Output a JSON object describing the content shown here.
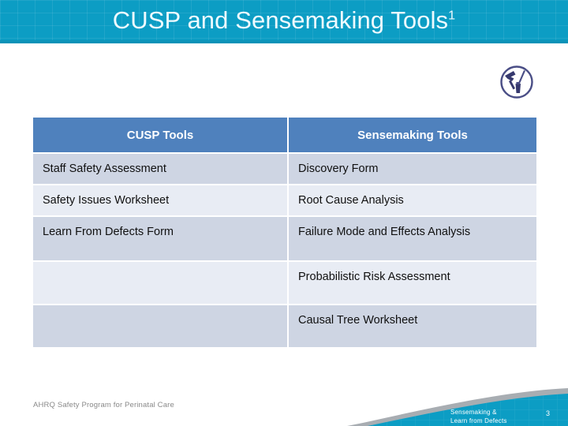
{
  "slide": {
    "title": "CUSP and Sensemaking Tools",
    "title_superscript": "1",
    "header_color": "#0c9dc4",
    "table_header_color": "#4f81bd",
    "row_color_a": "#ced5e3",
    "row_color_b": "#e8ecf4"
  },
  "logo": {
    "name": "toolkit-circle-logo",
    "color": "#36396e"
  },
  "table": {
    "headers": [
      "CUSP Tools",
      "Sensemaking Tools"
    ],
    "rows": [
      {
        "cusp": "Staff Safety Assessment",
        "sensemaking": "Discovery Form"
      },
      {
        "cusp": "Safety Issues Worksheet",
        "sensemaking": "Root Cause Analysis"
      },
      {
        "cusp": "Learn From Defects Form",
        "sensemaking": "Failure Mode and Effects Analysis"
      },
      {
        "cusp": "",
        "sensemaking": "Probabilistic Risk Assessment"
      },
      {
        "cusp": "",
        "sensemaking": "Causal Tree Worksheet"
      }
    ]
  },
  "footer": {
    "program": "AHRQ Safety Program for Perinatal Care",
    "module_line1": "Sensemaking &",
    "module_line2": "Learn from Defects",
    "page_number": "3"
  }
}
